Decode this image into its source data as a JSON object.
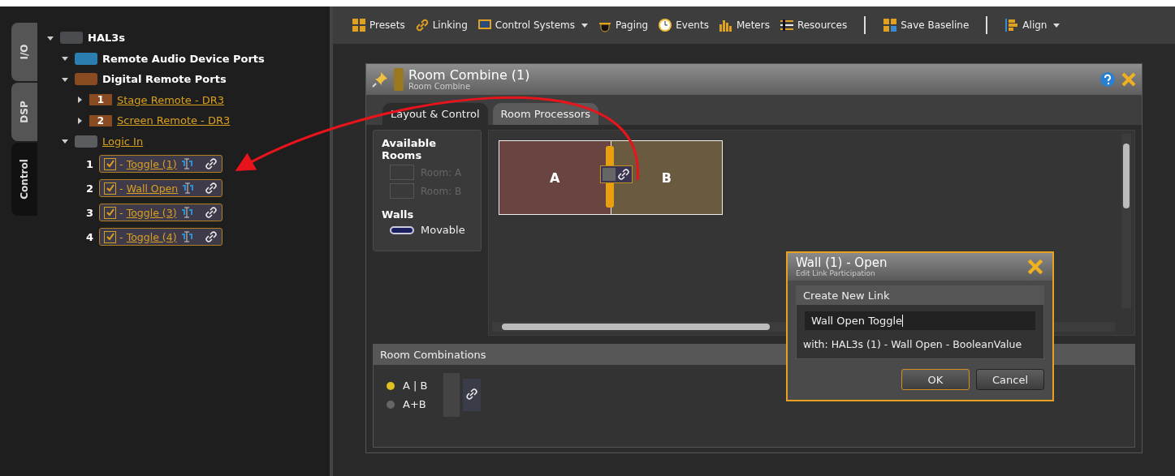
{
  "side_tabs": [
    {
      "label": "I/O",
      "selected": false
    },
    {
      "label": "DSP",
      "selected": false
    },
    {
      "label": "Control",
      "selected": true
    }
  ],
  "tree": [
    {
      "label": "HAL3s",
      "kind": "group",
      "color": "#4a4c50",
      "expanded": true,
      "children": [
        {
          "label": "Remote Audio Device Ports",
          "kind": "group",
          "color": "#2a7fb0",
          "expanded": true
        },
        {
          "label": "Digital Remote Ports",
          "kind": "group",
          "color": "#8a4a22",
          "expanded": true,
          "children": [
            {
              "label": "Stage Remote - DR3",
              "kind": "port",
              "number": "1",
              "expanded": false
            },
            {
              "label": "Screen Remote - DR3",
              "kind": "port",
              "number": "2",
              "expanded": false
            }
          ]
        },
        {
          "label": "Logic In",
          "kind": "link",
          "color": "#5a5c60",
          "expanded": true,
          "children": [
            {
              "label": "Toggle (1)",
              "prefix": "-",
              "kind": "logic",
              "number": "1",
              "checked": true
            },
            {
              "label": "Wall Open",
              "prefix": "-",
              "kind": "logic",
              "number": "2",
              "checked": true
            },
            {
              "label": "Toggle (3)",
              "prefix": "-",
              "kind": "logic",
              "number": "3",
              "checked": true
            },
            {
              "label": "Toggle (4)",
              "prefix": "-",
              "kind": "logic",
              "number": "4",
              "checked": true
            }
          ]
        }
      ]
    }
  ],
  "toolbar": [
    {
      "label": "Presets",
      "kind": "grid"
    },
    {
      "label": "Linking",
      "kind": "link"
    },
    {
      "label": "Control Systems",
      "kind": "screen",
      "dropdown": true
    },
    {
      "label": "Paging",
      "kind": "bell"
    },
    {
      "label": "Events",
      "kind": "clock"
    },
    {
      "label": "Meters",
      "kind": "meter"
    },
    {
      "label": "Resources",
      "kind": "sliders"
    },
    {
      "kind": "separator"
    },
    {
      "label": "Save Baseline",
      "kind": "save"
    },
    {
      "kind": "separator"
    },
    {
      "label": "Align",
      "kind": "align",
      "dropdown": true
    }
  ],
  "window": {
    "title": "Room Combine (1)",
    "subtitle": "Room Combine",
    "tabs": [
      {
        "label": "Layout & Control",
        "selected": true
      },
      {
        "label": "Room Processors",
        "selected": false
      }
    ],
    "available_rooms": {
      "title": "Available Rooms",
      "rooms": [
        "Room: A",
        "Room: B"
      ]
    },
    "walls": {
      "title": "Walls",
      "items": [
        "Movable"
      ]
    },
    "rooms": [
      "A",
      "B"
    ],
    "room_combinations": {
      "title": "Room Combinations",
      "items": [
        {
          "label": "A | B",
          "selected": true
        },
        {
          "label": "A+B",
          "selected": false
        }
      ]
    }
  },
  "dialog": {
    "title": "Wall (1) - Open",
    "subtitle": "Edit Link Participation",
    "section": "Create New Link",
    "value": "Wall Open Toggle",
    "with": "with: HAL3s (1) - Wall Open - BooleanValue",
    "buttons": [
      "OK",
      "Cancel"
    ]
  }
}
